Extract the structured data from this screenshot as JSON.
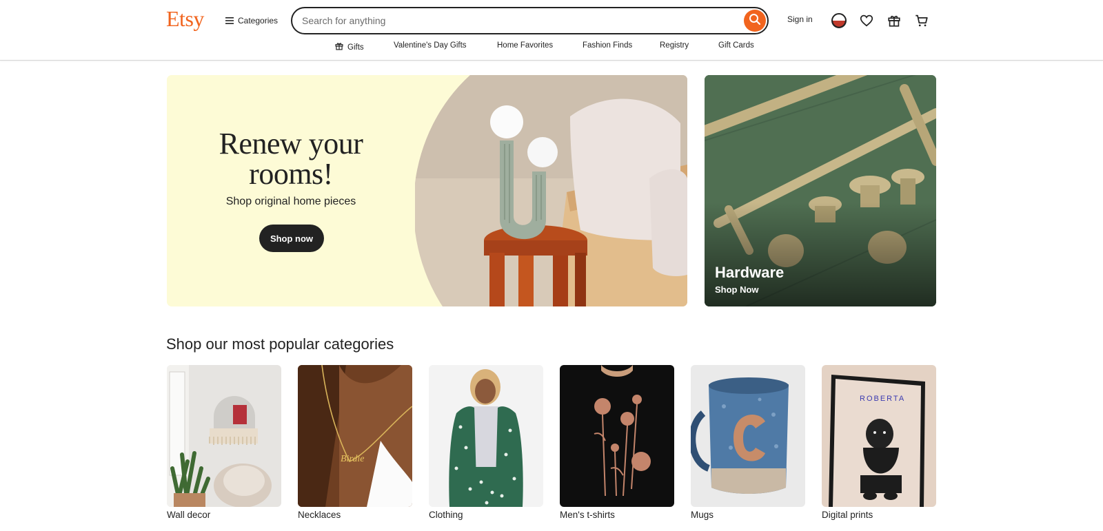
{
  "header": {
    "logo": "Etsy",
    "categories_label": "Categories",
    "search_placeholder": "Search for anything",
    "search_value": "",
    "signin_label": "Sign in",
    "accent_color": "#f1641e"
  },
  "subnav": {
    "items": [
      {
        "label": "Gifts",
        "icon": "gift-icon"
      },
      {
        "label": "Valentine's Day Gifts"
      },
      {
        "label": "Home Favorites"
      },
      {
        "label": "Fashion Finds"
      },
      {
        "label": "Registry"
      },
      {
        "label": "Gift Cards"
      }
    ]
  },
  "hero": {
    "title_line1": "Renew your",
    "title_line2": "rooms!",
    "subtitle": "Shop original home pieces",
    "button_label": "Shop now",
    "background_color": "#fdfbd6"
  },
  "side_card": {
    "title": "Hardware",
    "subtitle": "Shop Now"
  },
  "popular": {
    "title": "Shop our most popular categories",
    "items": [
      {
        "label": "Wall decor"
      },
      {
        "label": "Necklaces"
      },
      {
        "label": "Clothing"
      },
      {
        "label": "Men's t-shirts"
      },
      {
        "label": "Mugs"
      },
      {
        "label": "Digital prints",
        "print_text": "ROBERTA"
      }
    ]
  }
}
